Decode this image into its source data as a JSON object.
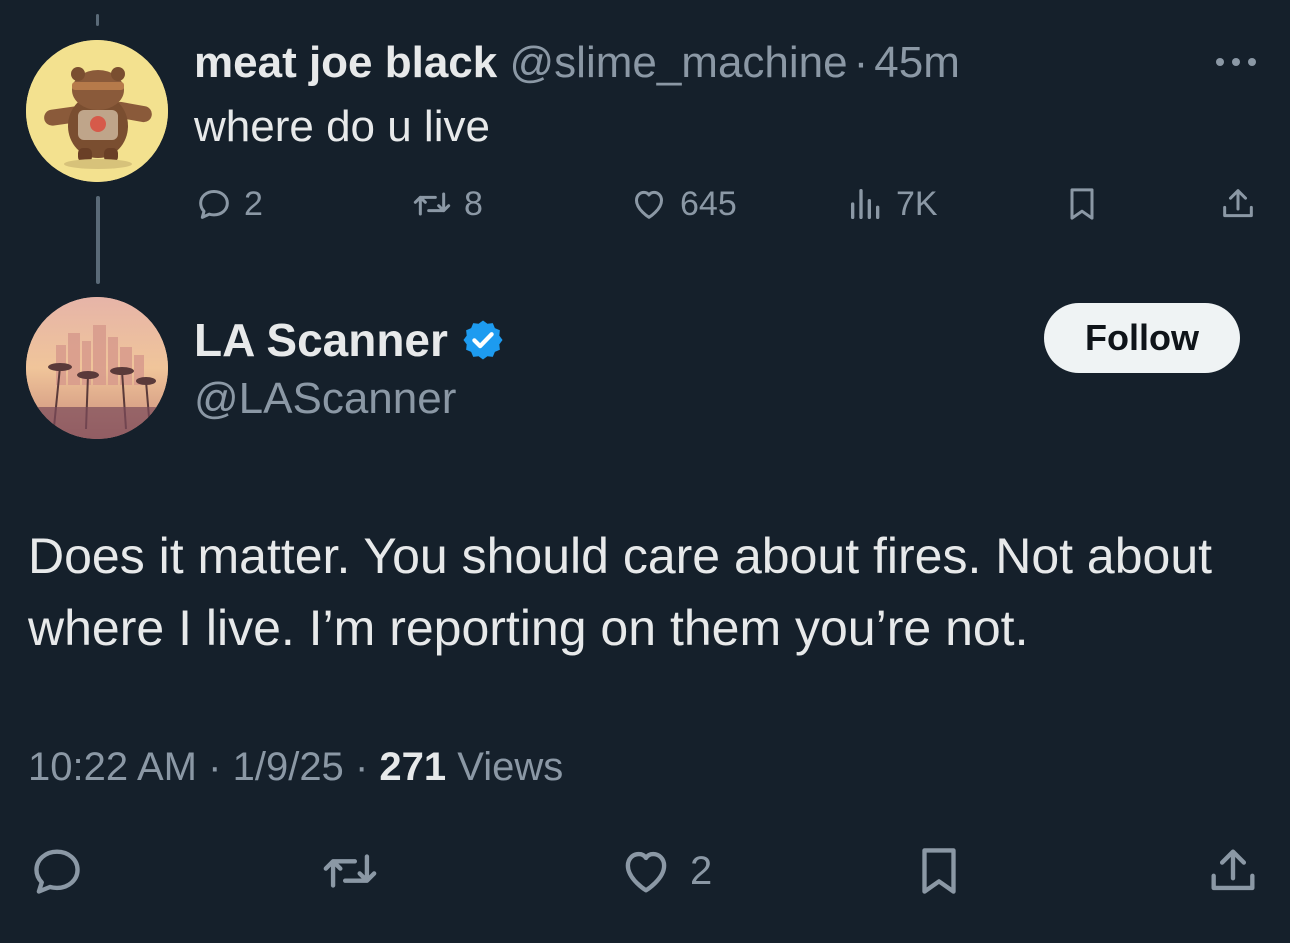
{
  "parent_tweet": {
    "display_name": "meat joe black",
    "handle": "@slime_machine",
    "separator": "·",
    "time_ago": "45m",
    "text": "where do u live",
    "actions": {
      "replies": "2",
      "reposts": "8",
      "likes": "645",
      "views": "7K"
    },
    "avatar_icon": "bear-mascot-avatar"
  },
  "reply_tweet": {
    "display_name": "LA Scanner",
    "handle": "@LAScanner",
    "verified": true,
    "follow_label": "Follow",
    "text": "Does it matter. You should care about fires. Not about where I live. I’m reporting on them you’re not.",
    "time": "10:22 AM",
    "separator": "·",
    "date": "1/9/25",
    "views_count": "271",
    "views_label": "Views",
    "likes": "2",
    "avatar_icon": "la-skyline-avatar"
  },
  "colors": {
    "background": "#15202b",
    "text_primary": "#e7e9ea",
    "text_secondary": "#8b98a5",
    "verified_blue": "#1d9bf0",
    "follow_bg": "#eff3f4"
  }
}
